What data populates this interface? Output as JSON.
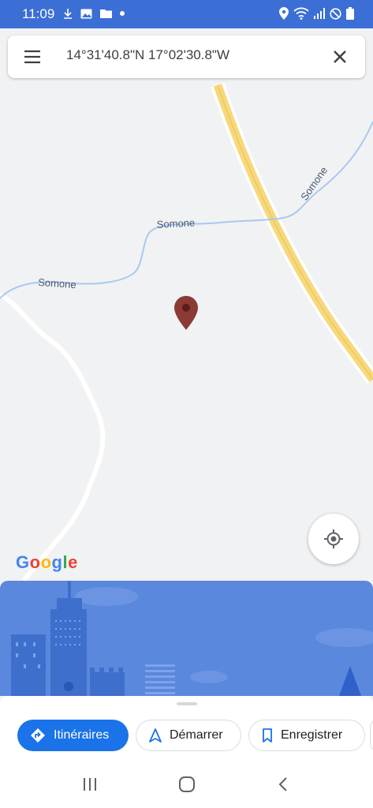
{
  "status": {
    "time": "11:09",
    "left_icons": [
      "download-icon",
      "image-icon",
      "folder-icon",
      "dot-icon"
    ],
    "right_icons": [
      "location-icon",
      "wifi-icon",
      "signal-icon",
      "dnd-icon",
      "battery-icon"
    ]
  },
  "search": {
    "query": "14°31'40.8\"N 17°02'30.8\"W"
  },
  "map": {
    "river_labels": [
      "Somone",
      "Somone",
      "Somone"
    ],
    "logo": "Google",
    "colors": {
      "road": "#f7d87b",
      "river": "#a9c8f1",
      "pin": "#8b3a34"
    }
  },
  "actions": {
    "directions": "Itinéraires",
    "start": "Démarrer",
    "save": "Enregistrer"
  },
  "colors": {
    "status_bar": "#3b6fd6",
    "accent": "#1a73e8",
    "illustration": "#5a88dd"
  }
}
